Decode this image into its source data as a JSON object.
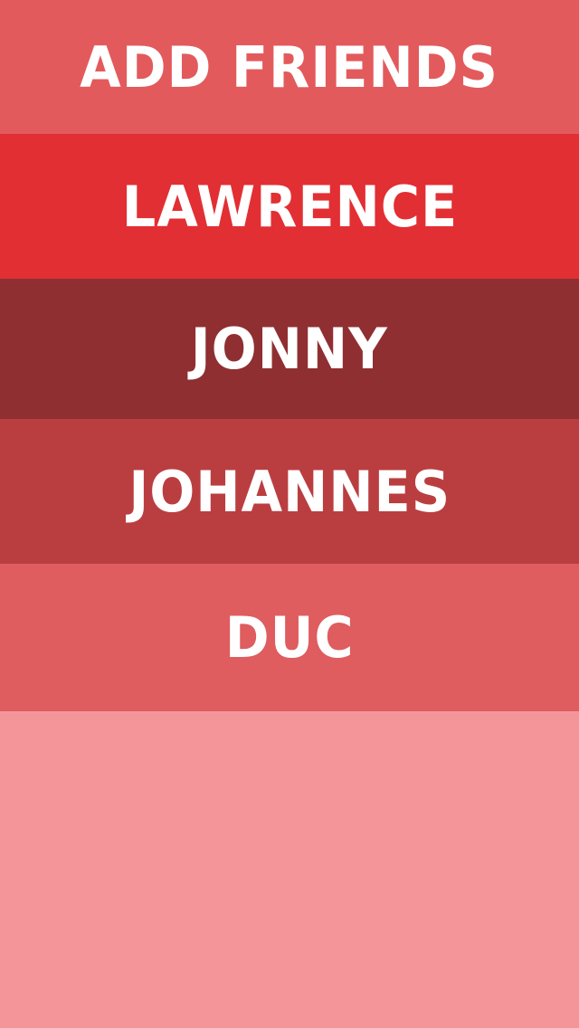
{
  "rows": [
    {
      "label": "ADD FRIENDS",
      "color": "#e35a5c"
    },
    {
      "label": "LAWRENCE",
      "color": "#e22f33"
    },
    {
      "label": "JONNY",
      "color": "#8f2f32"
    },
    {
      "label": "JOHANNES",
      "color": "#ba3e40"
    },
    {
      "label": "DUC",
      "color": "#df5c5f"
    }
  ],
  "empty_area_color": "#f4959a"
}
